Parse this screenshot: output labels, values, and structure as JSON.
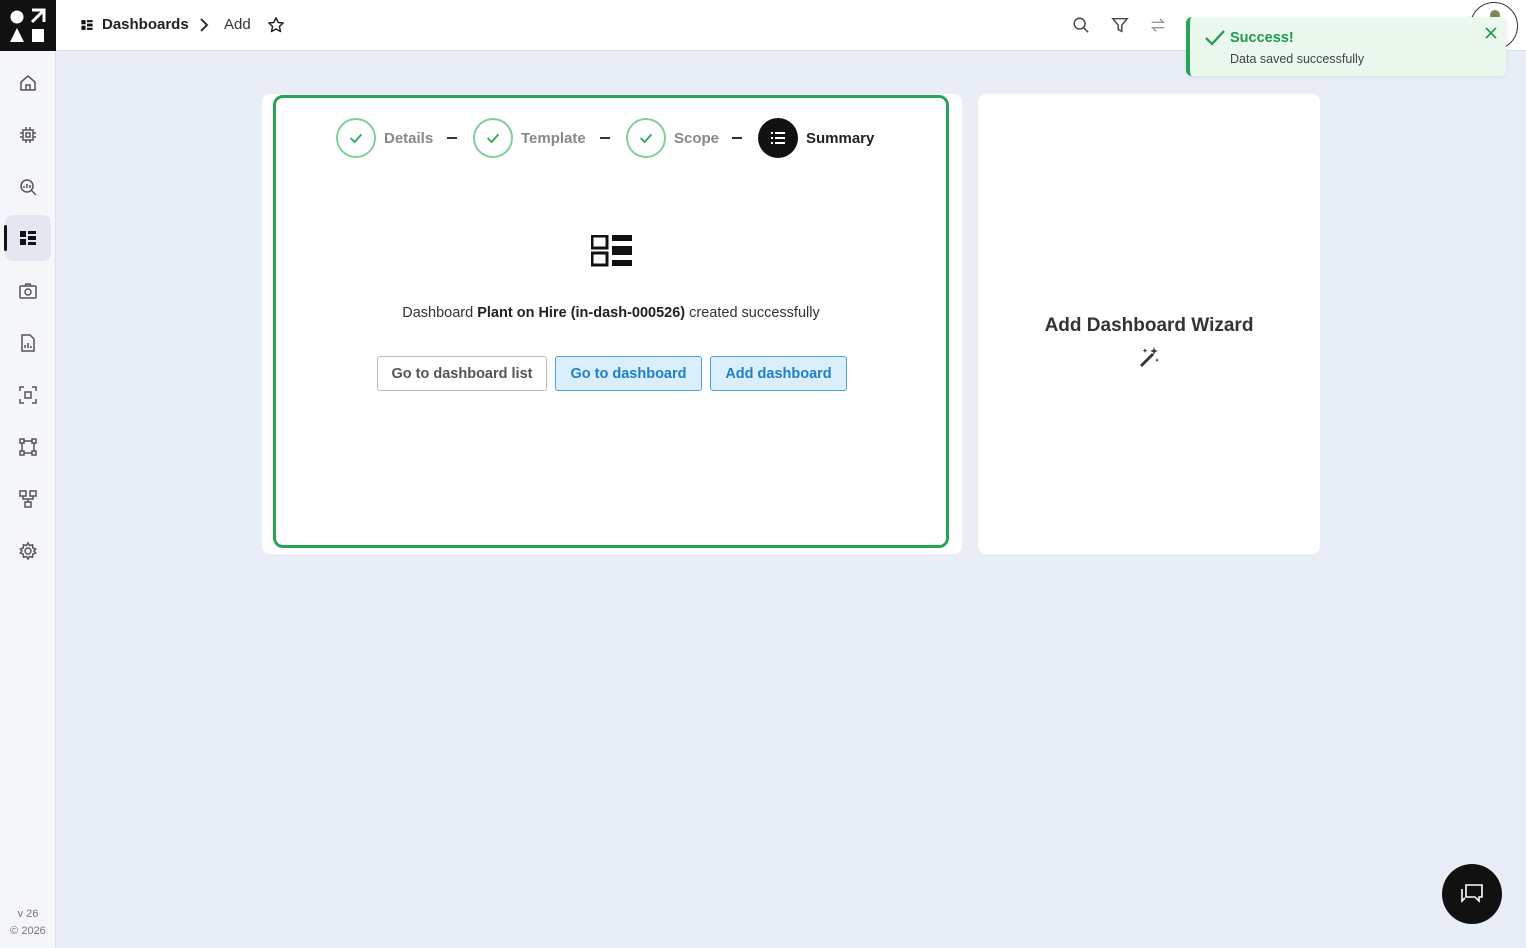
{
  "sidebar": {
    "items": [
      {
        "icon": "home-icon"
      },
      {
        "icon": "chip-icon"
      },
      {
        "icon": "search-analytics-icon"
      },
      {
        "icon": "dashboards-icon",
        "active": true
      },
      {
        "icon": "camera-icon"
      },
      {
        "icon": "report-icon"
      },
      {
        "icon": "selection-icon"
      },
      {
        "icon": "layout-icon"
      },
      {
        "icon": "hierarchy-icon"
      },
      {
        "icon": "settings-icon"
      }
    ],
    "version": "v 26",
    "copyright": "© 2026"
  },
  "header": {
    "breadcrumb_title": "Dashboards",
    "breadcrumb_current": "Add",
    "icons": [
      "search-icon",
      "filter-icon",
      "swap-icon"
    ]
  },
  "stepper": {
    "steps": [
      {
        "label": "Details",
        "state": "done"
      },
      {
        "label": "Template",
        "state": "done"
      },
      {
        "label": "Scope",
        "state": "done"
      },
      {
        "label": "Summary",
        "state": "active"
      }
    ]
  },
  "summary": {
    "prefix": "Dashboard",
    "name": "Plant on Hire (in-dash-000526)",
    "suffix": "created successfully",
    "buttons": {
      "list": "Go to dashboard list",
      "goto": "Go to dashboard",
      "add": "Add dashboard"
    }
  },
  "wizard": {
    "title": "Add Dashboard Wizard",
    "icon": "magic-wand-icon"
  },
  "toast": {
    "title": "Success!",
    "message": "Data saved successfully"
  },
  "colors": {
    "success": "#27a35a",
    "primary": "#1f7fc8",
    "dark": "#111111"
  }
}
